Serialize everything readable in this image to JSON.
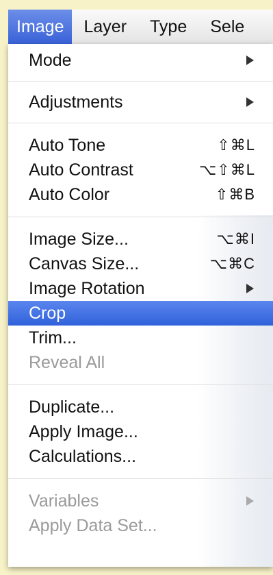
{
  "menubar": {
    "items": [
      {
        "label": "Image",
        "active": true
      },
      {
        "label": "Layer",
        "active": false
      },
      {
        "label": "Type",
        "active": false
      },
      {
        "label": "Sele",
        "active": false
      }
    ]
  },
  "menu": {
    "groups": [
      {
        "items": [
          {
            "label": "Mode",
            "shortcut": "",
            "submenu": true,
            "disabled": false
          }
        ]
      },
      {
        "items": [
          {
            "label": "Adjustments",
            "shortcut": "",
            "submenu": true,
            "disabled": false
          }
        ]
      },
      {
        "items": [
          {
            "label": "Auto Tone",
            "shortcut": "⇧⌘L",
            "submenu": false,
            "disabled": false
          },
          {
            "label": "Auto Contrast",
            "shortcut": "⌥⇧⌘L",
            "submenu": false,
            "disabled": false
          },
          {
            "label": "Auto Color",
            "shortcut": "⇧⌘B",
            "submenu": false,
            "disabled": false
          }
        ]
      },
      {
        "items": [
          {
            "label": "Image Size...",
            "shortcut": "⌥⌘I",
            "submenu": false,
            "disabled": false
          },
          {
            "label": "Canvas Size...",
            "shortcut": "⌥⌘C",
            "submenu": false,
            "disabled": false
          },
          {
            "label": "Image Rotation",
            "shortcut": "",
            "submenu": true,
            "disabled": false
          },
          {
            "label": "Crop",
            "shortcut": "",
            "submenu": false,
            "disabled": false,
            "highlighted": true
          },
          {
            "label": "Trim...",
            "shortcut": "",
            "submenu": false,
            "disabled": false
          },
          {
            "label": "Reveal All",
            "shortcut": "",
            "submenu": false,
            "disabled": true
          }
        ]
      },
      {
        "items": [
          {
            "label": "Duplicate...",
            "shortcut": "",
            "submenu": false,
            "disabled": false
          },
          {
            "label": "Apply Image...",
            "shortcut": "",
            "submenu": false,
            "disabled": false
          },
          {
            "label": "Calculations...",
            "shortcut": "",
            "submenu": false,
            "disabled": false
          }
        ]
      },
      {
        "items": [
          {
            "label": "Variables",
            "shortcut": "",
            "submenu": true,
            "disabled": true
          },
          {
            "label": "Apply Data Set...",
            "shortcut": "",
            "submenu": false,
            "disabled": true
          }
        ]
      }
    ]
  },
  "colors": {
    "frame": "#f2ecb8",
    "highlight": "#3a67dc",
    "disabled_text": "#9a9a9a"
  }
}
